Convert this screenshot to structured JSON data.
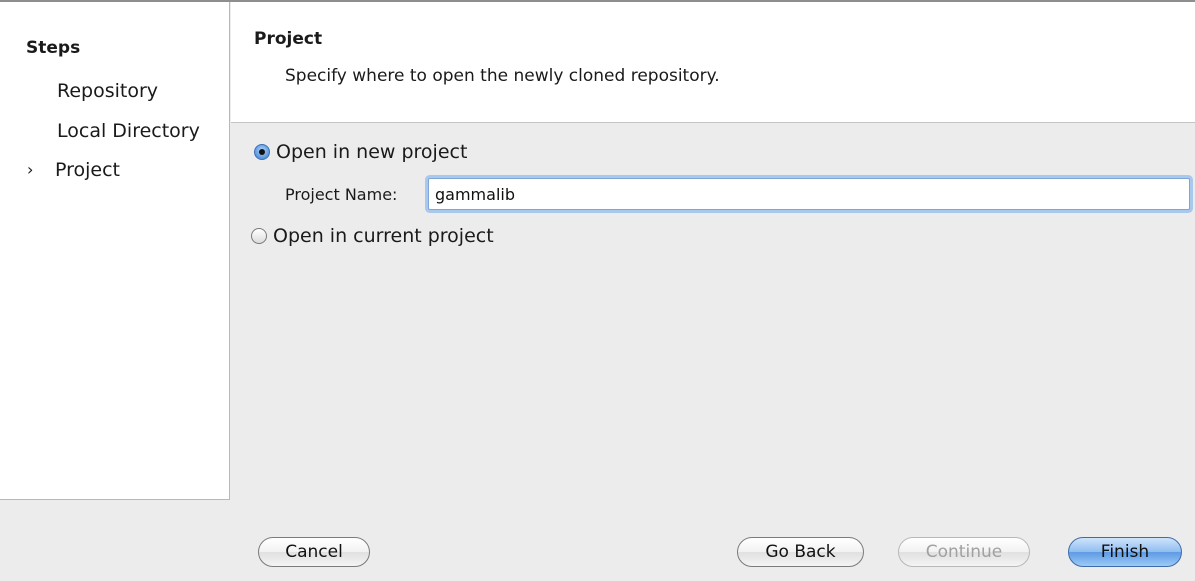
{
  "steps": {
    "title": "Steps",
    "items": [
      {
        "label": "Repository",
        "marker": ""
      },
      {
        "label": "Local Directory",
        "marker": ""
      },
      {
        "label": "Project",
        "marker": "›"
      }
    ]
  },
  "header": {
    "title": "Project",
    "description": "Specify where to open the newly cloned repository."
  },
  "options": {
    "new_project_label": "Open in new project",
    "current_project_label": "Open in current project",
    "selected": "new_project"
  },
  "project_name": {
    "label": "Project Name:",
    "value": "gammalib"
  },
  "buttons": {
    "cancel": "Cancel",
    "go_back": "Go Back",
    "continue": "Continue",
    "finish": "Finish"
  },
  "colors": {
    "accent": "#5d9ae4",
    "disabled_text": "#a0a0a0",
    "panel_background": "#ececec"
  }
}
